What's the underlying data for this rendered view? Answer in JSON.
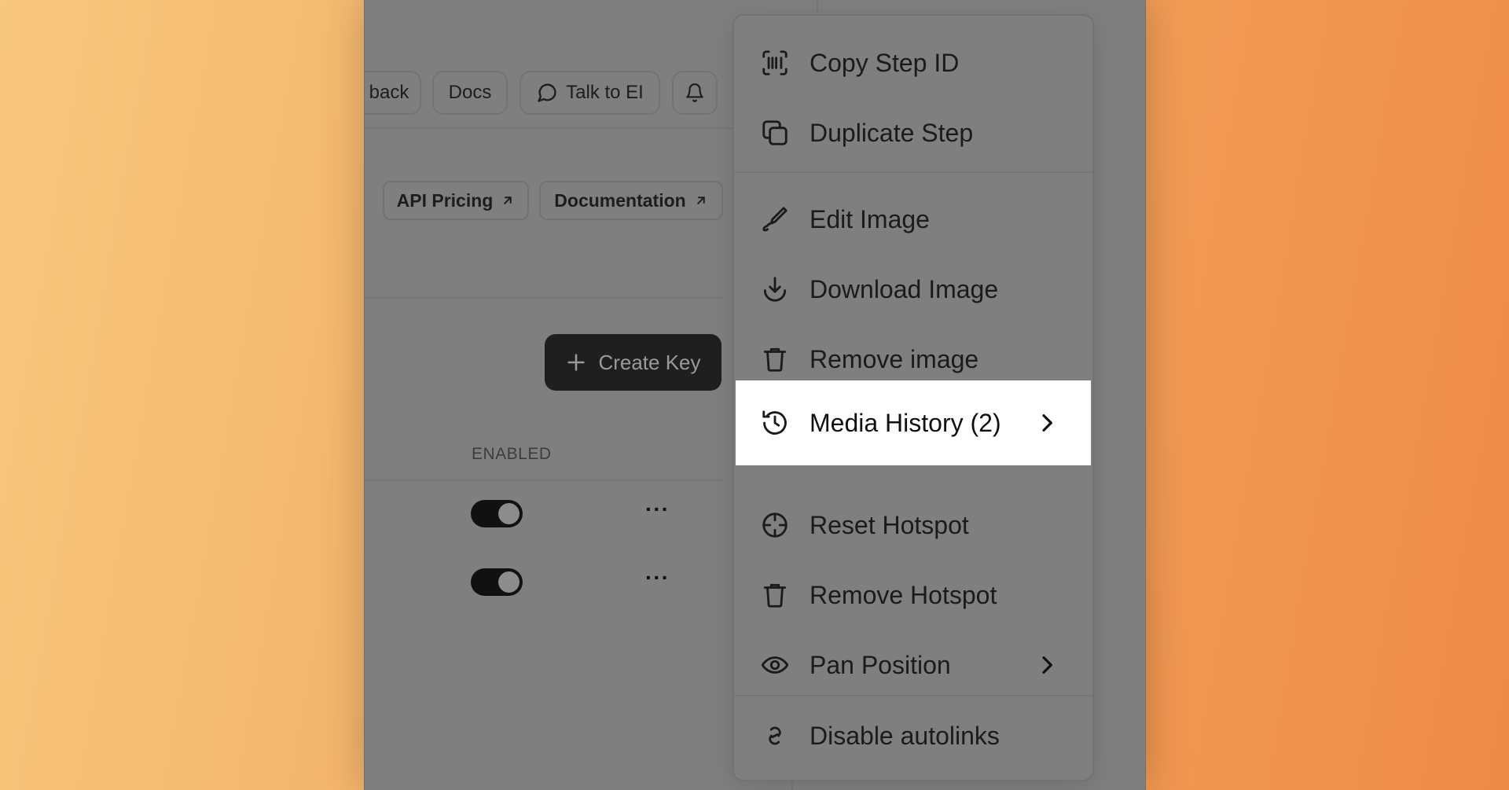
{
  "topbar": {
    "feedback_partial": "back",
    "docs": "Docs",
    "talk": "Talk to EI"
  },
  "links": {
    "api_pricing": "API Pricing",
    "documentation": "Documentation"
  },
  "create_key": "Create Key",
  "table": {
    "enabled_header": "ENABLED",
    "rows": [
      {
        "enabled": true,
        "more": "···"
      },
      {
        "enabled": true,
        "more": "···"
      }
    ]
  },
  "menu": {
    "items": [
      {
        "label": "Copy Step ID",
        "icon": "barcode-icon"
      },
      {
        "label": "Duplicate Step",
        "icon": "duplicate-icon"
      },
      {
        "label": "Edit Image",
        "icon": "pen-icon"
      },
      {
        "label": "Download Image",
        "icon": "download-icon"
      },
      {
        "label": "Remove image",
        "icon": "trash-icon"
      },
      {
        "label": "Media History (2)",
        "icon": "history-icon",
        "active": true,
        "submenu": true
      },
      {
        "label": "Reset Hotspot",
        "icon": "crosshair-icon"
      },
      {
        "label": "Remove Hotspot",
        "icon": "trash-icon"
      },
      {
        "label": "Pan Position",
        "icon": "eye-icon",
        "submenu": true
      },
      {
        "label": "Disable autolinks",
        "icon": "link-icon"
      }
    ]
  }
}
